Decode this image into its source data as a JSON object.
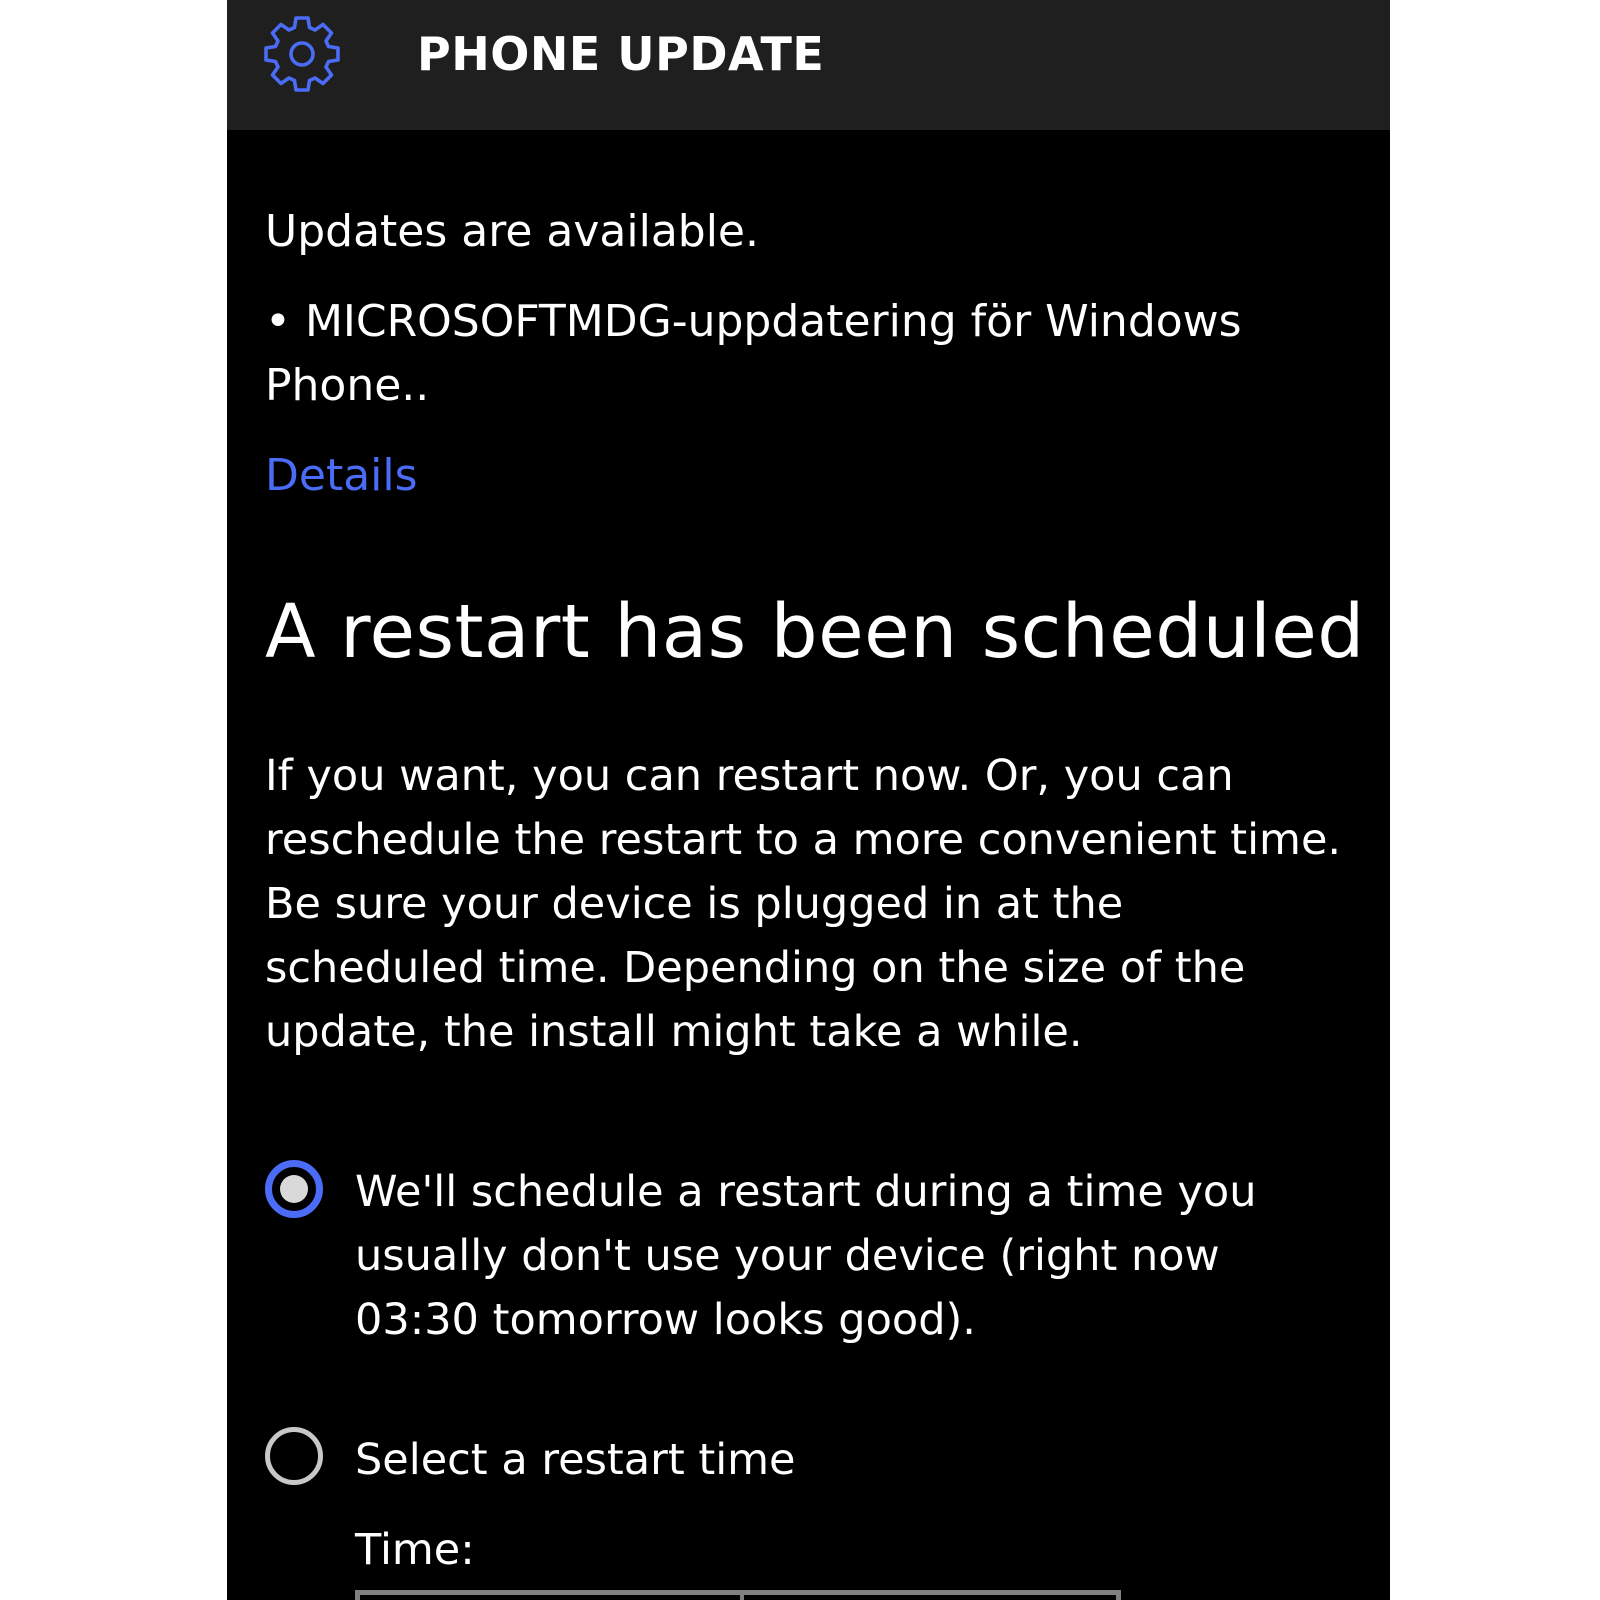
{
  "header": {
    "title": "PHONE UPDATE",
    "icon": "gear-icon",
    "accent_color": "#4a6cf7",
    "background": "#1f1f1f"
  },
  "status": {
    "message": "Updates are available.",
    "update_item": "• MICROSOFTMDG-uppdatering för Windows Phone..",
    "details_link": "Details"
  },
  "restart": {
    "heading": "A restart has been scheduled",
    "body": "If you want, you can restart now. Or, you can reschedule the restart to a more convenient time. Be sure your device is plugged in at the scheduled time. Depending on the size of the update, the install might take a while."
  },
  "options": {
    "auto_schedule": {
      "label": "We'll schedule a restart during a time you usually don't use your device (right now 03:30 tomorrow looks good).",
      "selected": true
    },
    "manual_schedule": {
      "label": "Select a restart time",
      "selected": false
    },
    "time_label": "Time:"
  }
}
